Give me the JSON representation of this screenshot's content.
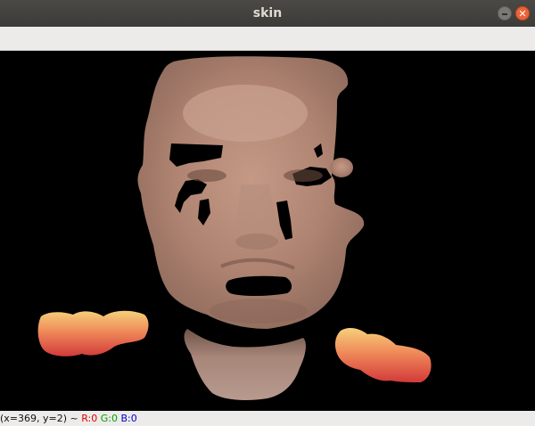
{
  "window": {
    "title": "skin"
  },
  "controls": {
    "minimize_label": "",
    "close_label": "✕"
  },
  "image": {
    "description_icon": "skin-mask-image"
  },
  "status": {
    "coords": "(x=369, y=2) ~ ",
    "r": "R:0",
    "g": "G:0",
    "b": "B:0"
  },
  "colors": {
    "titlebar": "#3c3b37",
    "toolbar": "#edebe9",
    "close": "#e9643a",
    "red": "#e00000",
    "green": "#00a000",
    "blue": "#0000d0"
  }
}
